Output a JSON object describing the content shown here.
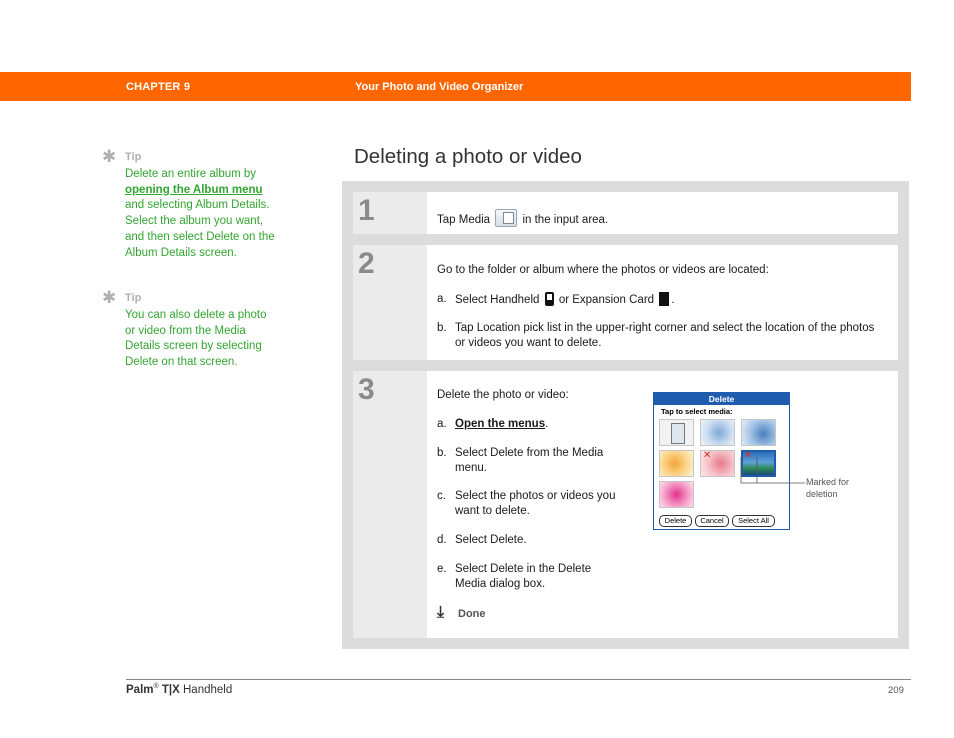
{
  "header": {
    "chapter": "CHAPTER 9",
    "title": "Your Photo and Video Organizer",
    "color": "#ff6600"
  },
  "tips": [
    {
      "label": "Tip",
      "text_before": "Delete an entire album by ",
      "link": "opening the Album menu",
      "text_after": " and selecting Album Details. Select the album you want, and then select Delete on the Album Details screen."
    },
    {
      "label": "Tip",
      "text": "You can also delete a photo or video from the Media Details screen by selecting Delete on that screen."
    }
  ],
  "section_title": "Deleting a photo or video",
  "steps": [
    {
      "number": "1",
      "before_icon": "Tap Media",
      "icon": "media-icon",
      "after_icon": "in the input area."
    },
    {
      "number": "2",
      "intro": "Go to the folder or album where the photos or videos are located:",
      "a_letter": "a.",
      "a_before": "Select Handheld",
      "a_mid": "or Expansion Card",
      "a_end": ".",
      "b_letter": "b.",
      "b_text": "Tap Location pick list in the upper-right corner and select the location of the photos or videos you want to delete."
    },
    {
      "number": "3",
      "intro": "Delete the photo or video:",
      "items": [
        {
          "letter": "a.",
          "link": "Open the menus",
          "after": "."
        },
        {
          "letter": "b.",
          "text": "Select Delete from the Media menu."
        },
        {
          "letter": "c.",
          "text": "Select the photos or videos you want to delete."
        },
        {
          "letter": "d.",
          "text": "Select Delete."
        },
        {
          "letter": "e.",
          "text": "Select Delete in the Delete Media dialog box."
        }
      ],
      "done": "Done"
    }
  ],
  "dialog": {
    "title": "Delete",
    "prompt": "Tap to select media:",
    "buttons": [
      "Delete",
      "Cancel",
      "Select All"
    ],
    "accent": "#1f5cae"
  },
  "callout": "Marked for deletion",
  "footer": {
    "brand": "Palm",
    "reg": "®",
    "model": "T|X",
    "suffix": "Handheld",
    "page": "209"
  }
}
